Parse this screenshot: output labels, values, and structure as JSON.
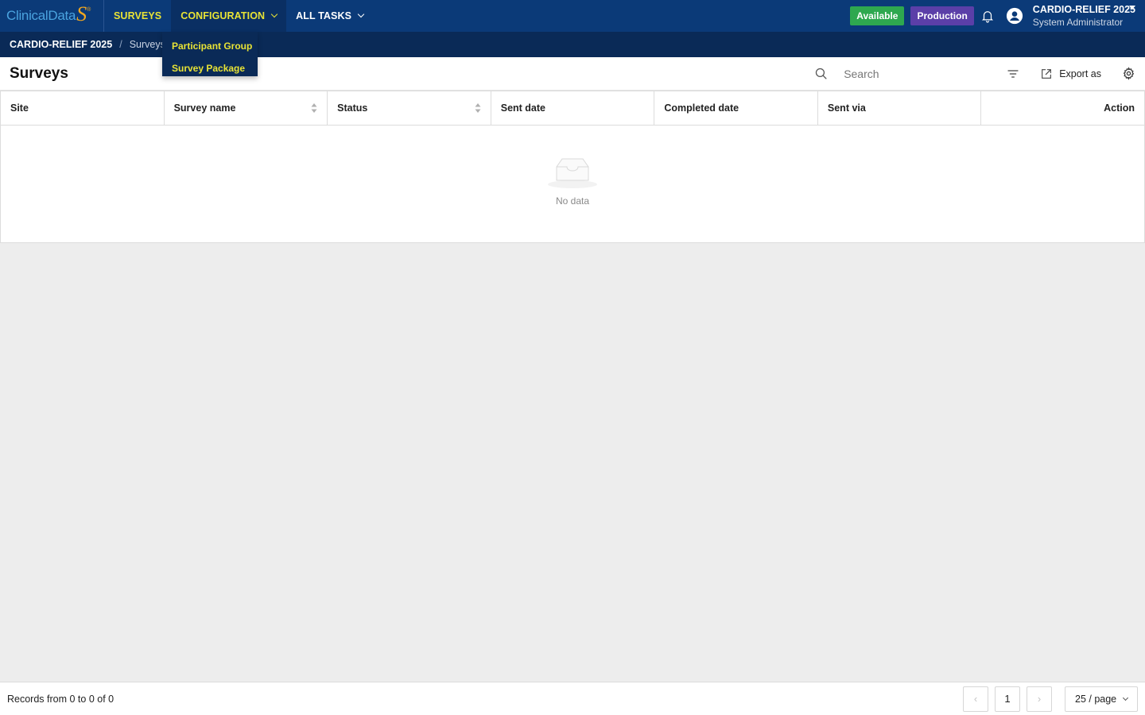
{
  "brand": {
    "logo_text": "ClinicalData",
    "logo_mark": "S",
    "logo_reg": "®"
  },
  "nav": {
    "items": [
      {
        "label": "SURVEYS",
        "active": true
      },
      {
        "label": "CONFIGURATION",
        "open": true
      },
      {
        "label": "ALL TASKS"
      }
    ],
    "dropdown": [
      "Participant Group",
      "Survey Package"
    ]
  },
  "status": {
    "available": "Available",
    "environment": "Production"
  },
  "user": {
    "study": "CARDIO-RELIEF 2025",
    "role": "System Administrator"
  },
  "breadcrumb": {
    "root": "CARDIO-RELIEF 2025",
    "separator": "/",
    "current": "Surveys"
  },
  "page": {
    "title": "Surveys"
  },
  "search": {
    "placeholder": "Search"
  },
  "toolbar": {
    "export_label": "Export as"
  },
  "table": {
    "columns": [
      "Site",
      "Survey name",
      "Status",
      "Sent date",
      "Completed date",
      "Sent via",
      "Action"
    ],
    "empty_text": "No data"
  },
  "footer": {
    "records": "Records from 0 to 0 of 0",
    "current_page": "1",
    "page_size": "25 / page",
    "prev": "‹",
    "next": "›"
  },
  "colors": {
    "nav_bg": "#0b3a78",
    "nav_accent": "#e8e335",
    "available": "#2ea84f",
    "production": "#5b3fa8"
  }
}
